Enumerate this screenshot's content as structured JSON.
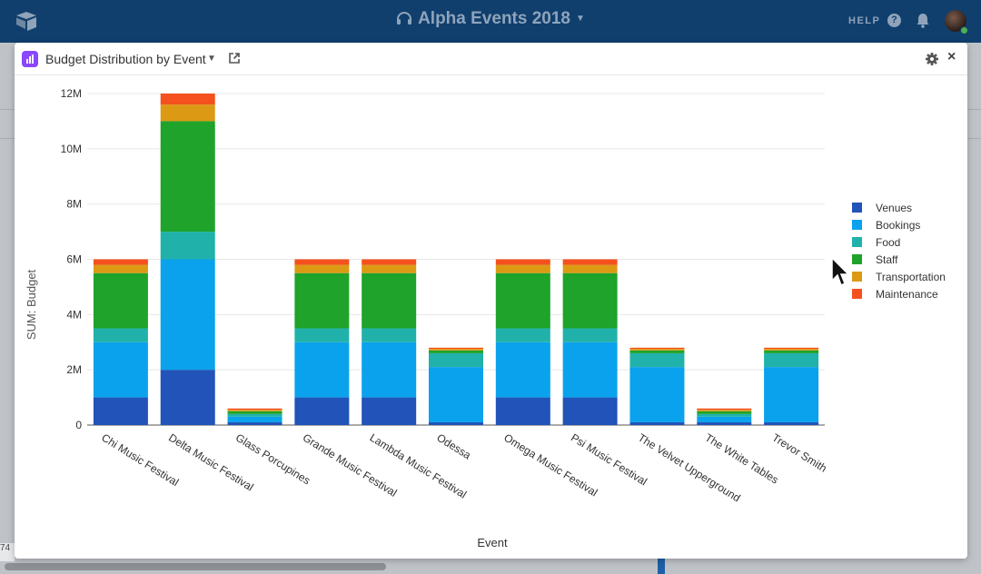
{
  "app": {
    "base_title": "Alpha Events 2018",
    "help_label": "HELP",
    "help_icon_glyph": "?"
  },
  "background": {
    "cell_value": "74"
  },
  "panel": {
    "title": "Budget Distribution by Event",
    "close_glyph": "×"
  },
  "colors": {
    "topbar": "#103f6e",
    "block_icon": "#8b46ff"
  },
  "chart_data": {
    "type": "bar",
    "stacked": true,
    "xlabel": "Event",
    "ylabel": "SUM: Budget",
    "ylim": [
      0,
      12000000
    ],
    "yticks": [
      0,
      2000000,
      4000000,
      6000000,
      8000000,
      10000000,
      12000000
    ],
    "ytick_labels": [
      "0",
      "2M",
      "4M",
      "6M",
      "8M",
      "10M",
      "12M"
    ],
    "grid": true,
    "legend_position": "right",
    "categories": [
      "Chi Music Festival",
      "Delta Music Festival",
      "Glass Porcupines",
      "Grande Music Festival",
      "Lambda Music Festival",
      "Odessa",
      "Omega Music Festival",
      "Psi Music Festival",
      "The Velvet Upperground",
      "The White Tables",
      "Trevor Smith"
    ],
    "series": [
      {
        "name": "Venues",
        "color": "#2153b8",
        "values": [
          1000000,
          2000000,
          100000,
          1000000,
          1000000,
          100000,
          1000000,
          1000000,
          100000,
          100000,
          100000
        ]
      },
      {
        "name": "Bookings",
        "color": "#0aa2ec",
        "values": [
          2000000,
          4000000,
          200000,
          2000000,
          2000000,
          2000000,
          2000000,
          2000000,
          2000000,
          200000,
          2000000
        ]
      },
      {
        "name": "Food",
        "color": "#20b2aa",
        "values": [
          500000,
          1000000,
          100000,
          500000,
          500000,
          500000,
          500000,
          500000,
          500000,
          100000,
          500000
        ]
      },
      {
        "name": "Staff",
        "color": "#1fa32a",
        "values": [
          2000000,
          4000000,
          100000,
          2000000,
          2000000,
          100000,
          2000000,
          2000000,
          100000,
          100000,
          100000
        ]
      },
      {
        "name": "Transportation",
        "color": "#dc9a14",
        "values": [
          300000,
          600000,
          50000,
          300000,
          300000,
          60000,
          300000,
          300000,
          60000,
          50000,
          60000
        ]
      },
      {
        "name": "Maintenance",
        "color": "#f4511e",
        "values": [
          200000,
          400000,
          50000,
          200000,
          200000,
          40000,
          200000,
          200000,
          40000,
          50000,
          40000
        ]
      }
    ]
  }
}
